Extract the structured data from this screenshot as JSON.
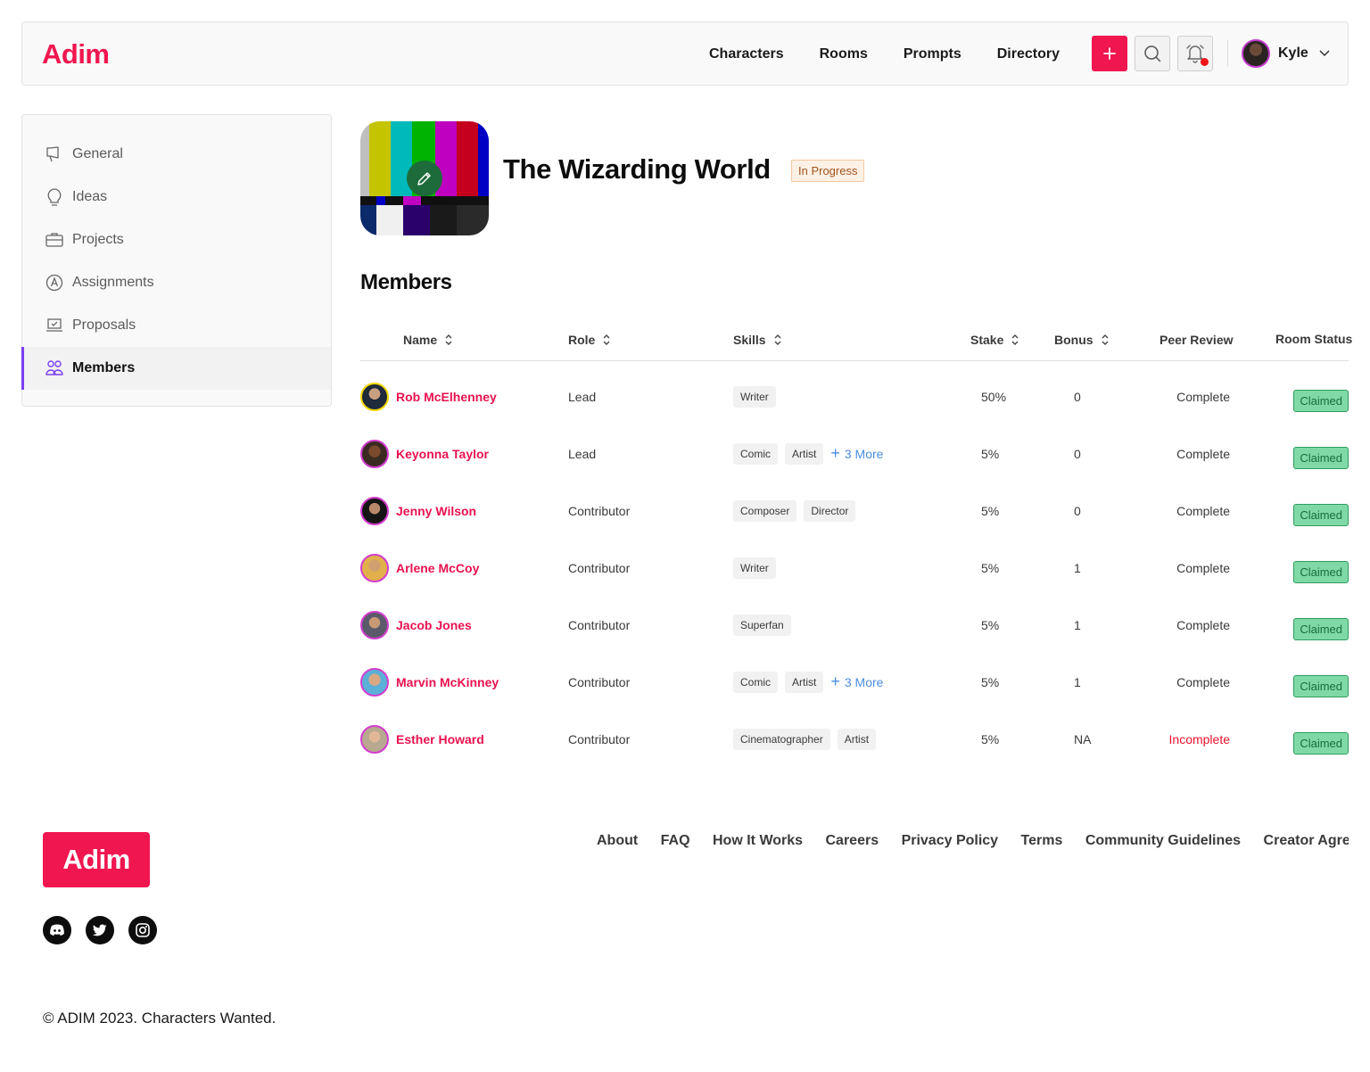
{
  "brand": {
    "name": "Adim",
    "color": "#f0164f"
  },
  "nav": {
    "links": [
      "Characters",
      "Rooms",
      "Prompts",
      "Directory"
    ],
    "add_icon": "plus-icon",
    "search_icon": "search-icon",
    "notification_icon": "bell-icon",
    "user": {
      "name": "Kyle"
    }
  },
  "sidebar": {
    "items": [
      {
        "label": "General",
        "icon": "megaphone-icon",
        "active": false
      },
      {
        "label": "Ideas",
        "icon": "lightbulb-icon",
        "active": false
      },
      {
        "label": "Projects",
        "icon": "briefcase-icon",
        "active": false
      },
      {
        "label": "Assignments",
        "icon": "assignment-icon",
        "active": false
      },
      {
        "label": "Proposals",
        "icon": "laptop-icon",
        "active": false
      },
      {
        "label": "Members",
        "icon": "members-icon",
        "active": true
      }
    ],
    "accent": "#7b3ff2"
  },
  "room": {
    "title": "The Wizarding World",
    "status": "In Progress"
  },
  "members": {
    "title": "Members",
    "columns": {
      "name": "Name",
      "role": "Role",
      "skills": "Skills",
      "stake": "Stake",
      "bonus": "Bonus",
      "peer_review": "Peer Review",
      "room_status": "Room Status"
    },
    "rows": [
      {
        "name": "Rob McElhenney",
        "role": "Lead",
        "skills": [
          "Writer"
        ],
        "more": "",
        "stake": "50%",
        "bonus": "0",
        "peer_review": "Complete",
        "room_status": "Claimed"
      },
      {
        "name": "Keyonna Taylor",
        "role": "Lead",
        "skills": [
          "Comic",
          "Artist"
        ],
        "more": "3 More",
        "stake": "5%",
        "bonus": "0",
        "peer_review": "Complete",
        "room_status": "Claimed"
      },
      {
        "name": "Jenny Wilson",
        "role": "Contributor",
        "skills": [
          "Composer",
          "Director"
        ],
        "more": "",
        "stake": "5%",
        "bonus": "0",
        "peer_review": "Complete",
        "room_status": "Claimed"
      },
      {
        "name": "Arlene McCoy",
        "role": "Contributor",
        "skills": [
          "Writer"
        ],
        "more": "",
        "stake": "5%",
        "bonus": "1",
        "peer_review": "Complete",
        "room_status": "Claimed"
      },
      {
        "name": "Jacob Jones",
        "role": "Contributor",
        "skills": [
          "Superfan"
        ],
        "more": "",
        "stake": "5%",
        "bonus": "1",
        "peer_review": "Complete",
        "room_status": "Claimed"
      },
      {
        "name": "Marvin McKinney",
        "role": "Contributor",
        "skills": [
          "Comic",
          "Artist"
        ],
        "more": "3 More",
        "stake": "5%",
        "bonus": "1",
        "peer_review": "Complete",
        "room_status": "Claimed"
      },
      {
        "name": "Esther Howard",
        "role": "Contributor",
        "skills": [
          "Cinematographer",
          "Artist"
        ],
        "more": "",
        "stake": "5%",
        "bonus": "NA",
        "peer_review": "Incomplete",
        "room_status": "Claimed"
      }
    ]
  },
  "footer": {
    "logo": "Adim",
    "links": [
      "About",
      "FAQ",
      "How It Works",
      "Careers",
      "Privacy Policy",
      "Terms",
      "Community Guidelines",
      "Creator Agreem"
    ],
    "social": [
      "discord-icon",
      "twitter-icon",
      "instagram-icon"
    ],
    "copyright": "© ADIM 2023. Characters Wanted."
  }
}
